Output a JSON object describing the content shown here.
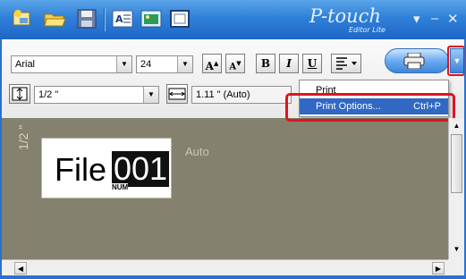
{
  "app": {
    "logo_text": "P-touch",
    "logo_sub": "Editor Lite",
    "window_controls": {
      "dropdown": "▾",
      "minimize": "–",
      "close": "✕"
    }
  },
  "titlebar_icons": [
    "new-label-icon",
    "open-folder-icon",
    "save-icon",
    "text-icon",
    "image-icon",
    "frame-icon"
  ],
  "font_row": {
    "font_name": "Arial",
    "font_size": "24",
    "size_up": "A",
    "size_down": "A",
    "bold": "B",
    "italic": "I",
    "underline": "U",
    "align_icon": "align-icon"
  },
  "tape_row": {
    "tape_width": "1/2 \"",
    "label_length": "1.11 \" (Auto)"
  },
  "print_menu": {
    "item_print": "Print",
    "item_print_options": "Print Options...",
    "item_print_options_shortcut": "Ctrl+P"
  },
  "canvas": {
    "tape_size_label": "1/2 \"",
    "length_label": "Auto",
    "label_text": "File",
    "number_text": "001",
    "number_tag": "NUM"
  },
  "colors": {
    "title_bar": "#2f80d8",
    "highlight_box": "#e0141e",
    "menu_selection": "#3168c4",
    "canvas_bg": "#84816f"
  }
}
